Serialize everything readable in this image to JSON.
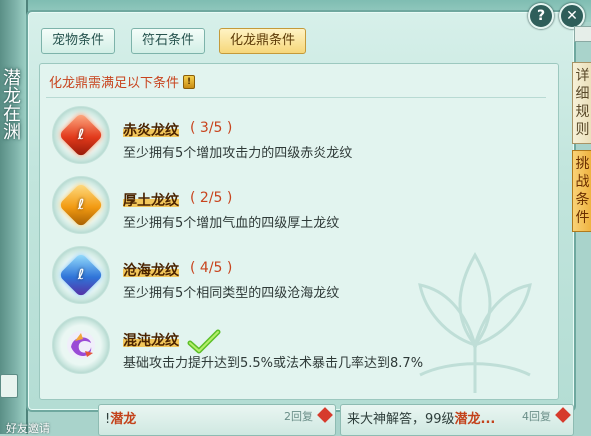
{
  "window": {
    "rail_title": "潜龙在渊",
    "bottom_left_label": "好友邀请",
    "help_symbol": "?",
    "close_symbol": "✕"
  },
  "tabs": [
    {
      "label": "宠物条件",
      "active": false
    },
    {
      "label": "符石条件",
      "active": false
    },
    {
      "label": "化龙鼎条件",
      "active": true
    }
  ],
  "side_tabs": [
    {
      "label": "详细规则",
      "active": false
    },
    {
      "label": "挑战条件",
      "active": true
    }
  ],
  "panel": {
    "header": "化龙鼎需满足以下条件",
    "info_symbol": "!"
  },
  "conditions": [
    {
      "title": "赤炎龙纹",
      "progress": "( 3/5 )",
      "description": "至少拥有5个增加攻击力的四级赤炎龙纹",
      "gem": "red-gem-icon",
      "color": "#e24a2c",
      "completed": false
    },
    {
      "title": "厚土龙纹",
      "progress": "( 2/5 )",
      "description": "至少拥有5个增加气血的四级厚土龙纹",
      "gem": "orange-gem-icon",
      "color": "#f0a01a",
      "completed": false
    },
    {
      "title": "沧海龙纹",
      "progress": "( 4/5 )",
      "description": "至少拥有5个相同类型的四级沧海龙纹",
      "gem": "blue-gem-icon",
      "color": "#2f74d8",
      "completed": false
    },
    {
      "title": "混沌龙纹",
      "progress": "",
      "description": "基础攻击力提升达到5.5%或法术暴击几率达到8.7%",
      "gem": "purple-chaos-icon",
      "color": "#a05ad0",
      "completed": true
    }
  ],
  "chat": [
    {
      "name": "潜龙",
      "meta": "2回复"
    },
    {
      "name": "潜龙...",
      "prefix": "来大神解答，99级",
      "meta": "4回复"
    }
  ]
}
